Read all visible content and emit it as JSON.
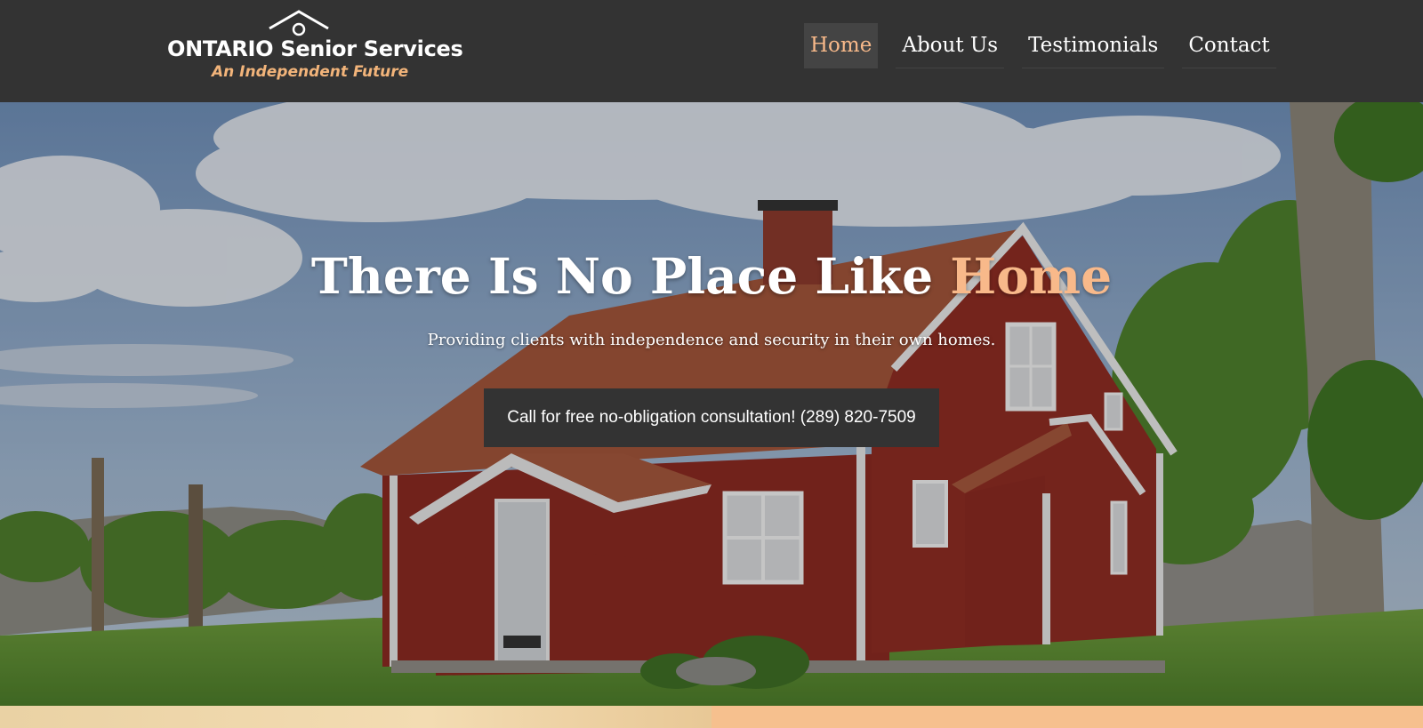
{
  "logo": {
    "name": "ONTARIO Senior Services",
    "tagline": "An Independent Future",
    "icon": "house-roof-icon"
  },
  "nav": {
    "items": [
      {
        "label": "Home",
        "active": true
      },
      {
        "label": "About Us",
        "active": false
      },
      {
        "label": "Testimonials",
        "active": false
      },
      {
        "label": "Contact",
        "active": false
      }
    ]
  },
  "hero": {
    "title_main": "There Is No Place Like ",
    "title_accent": "Home",
    "subtitle": "Providing clients with independence and security in their own homes.",
    "cta_label": "Call for free no-obligation consultation! (289) 820-7509"
  },
  "colors": {
    "header_bg": "#333333",
    "accent": "#f8b98a",
    "button_bg": "#333333",
    "strip_right": "#f6c08e"
  }
}
